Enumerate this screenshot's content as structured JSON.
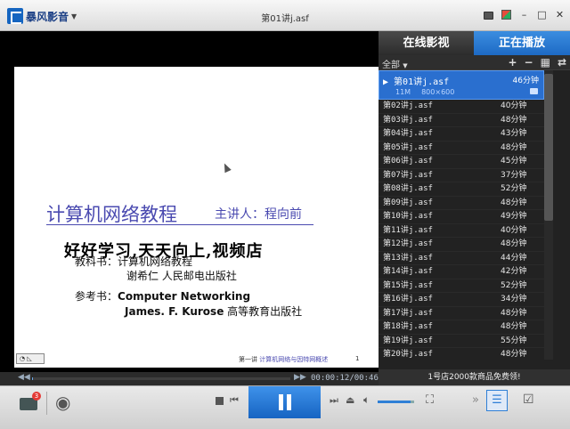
{
  "app": {
    "logo_text": "暴风影音",
    "window_title": "第01讲j.asf"
  },
  "video": {
    "slide_title": "计算机网络教程",
    "slide_speaker": "主讲人：程向前",
    "watermark": "好好学习,天天向上,视频店",
    "textbook_label": "教科书：计算机网络教程",
    "textbook_authors": "谢希仁  人民邮电出版社",
    "reference_label": "参考书：",
    "reference_title": "Computer Networking",
    "reference_authors": "James. F. Kurose",
    "reference_publisher": "高等教育出版社",
    "footer_prefix": "第一讲",
    "footer_topic": "计算机网络与因特网概述",
    "page_number": "1"
  },
  "seek": {
    "time": "00:00:12/00:46:05",
    "progress": 0.0043
  },
  "panel": {
    "tab_online": "在线影视",
    "tab_playing": "正在播放",
    "filter": "全部",
    "active_item": {
      "name": "第01讲j.asf",
      "duration": "46分钟",
      "size": "11M",
      "resolution": "800×600"
    },
    "items": [
      {
        "name": "第02讲j.asf",
        "duration": "40分钟"
      },
      {
        "name": "第03讲j.asf",
        "duration": "48分钟"
      },
      {
        "name": "第04讲j.asf",
        "duration": "43分钟"
      },
      {
        "name": "第05讲j.asf",
        "duration": "48分钟"
      },
      {
        "name": "第06讲j.asf",
        "duration": "45分钟"
      },
      {
        "name": "第07讲j.asf",
        "duration": "37分钟"
      },
      {
        "name": "第08讲j.asf",
        "duration": "52分钟"
      },
      {
        "name": "第09讲j.asf",
        "duration": "48分钟"
      },
      {
        "name": "第10讲j.asf",
        "duration": "49分钟"
      },
      {
        "name": "第11讲j.asf",
        "duration": "40分钟"
      },
      {
        "name": "第12讲j.asf",
        "duration": "48分钟"
      },
      {
        "name": "第13讲j.asf",
        "duration": "44分钟"
      },
      {
        "name": "第14讲j.asf",
        "duration": "42分钟"
      },
      {
        "name": "第15讲j.asf",
        "duration": "52分钟"
      },
      {
        "name": "第16讲j.asf",
        "duration": "34分钟"
      },
      {
        "name": "第17讲j.asf",
        "duration": "48分钟"
      },
      {
        "name": "第18讲j.asf",
        "duration": "48分钟"
      },
      {
        "name": "第19讲j.asf",
        "duration": "55分钟"
      },
      {
        "name": "第20讲j.asf",
        "duration": "48分钟"
      }
    ],
    "promo": "1号店2000款商品免费领!"
  },
  "controls": {
    "badge_count": "3",
    "volume": 0.9
  },
  "colors": {
    "accent": "#1d6ac4",
    "slide_text": "#4a4ab0"
  }
}
